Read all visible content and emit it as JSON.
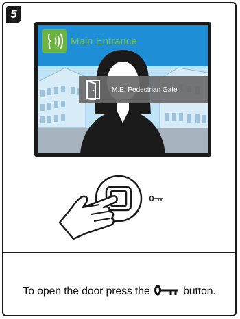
{
  "step_number": "5",
  "screen": {
    "title": "Main Entrance",
    "speak_icon": "speaking-head-icon",
    "gate_icon": "door-icon",
    "gate_label": "M.E. Pedestrian Gate"
  },
  "illustration": {
    "hand_icon": "pointing-hand-icon",
    "button_icon": "key-icon"
  },
  "instruction": {
    "before": "To open the door press the",
    "after": "button."
  },
  "colors": {
    "sky": "#1e8fd6",
    "accent_green": "#6db33f",
    "overlay": "#696969"
  }
}
